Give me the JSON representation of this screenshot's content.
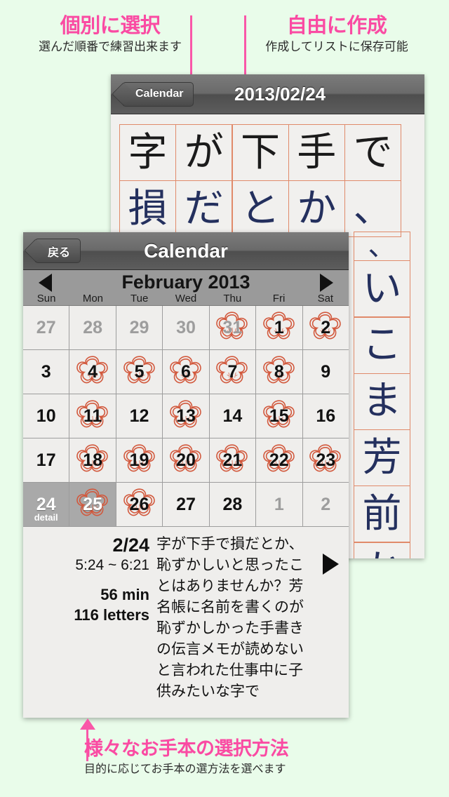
{
  "theme": {
    "page_background": "#e9fcea",
    "accent_pink": "#fa4ba3",
    "paper": "#efeeec",
    "stamp_red": "#d9583c",
    "selected_gray": "#a9a9a9"
  },
  "annotations": {
    "left": {
      "title": "個別に選択",
      "subtitle": "選んだ順番で練習出来ます"
    },
    "right": {
      "title": "自由に作成",
      "subtitle": "作成してリストに保存可能"
    },
    "bottom": {
      "title": "様々なお手本の選択方法",
      "subtitle": "目的に応じてお手本の選方法を選べます"
    }
  },
  "practice_app": {
    "navbar": {
      "back_label": "Calendar",
      "title": "2013/02/24"
    },
    "grid_rows": [
      [
        "字",
        "が",
        "下",
        "手",
        "で"
      ],
      [
        "損",
        "だ",
        "と",
        "か",
        "、"
      ]
    ],
    "right_column": [
      "、",
      "い",
      "こ",
      "ま",
      "芳",
      "前",
      "か"
    ]
  },
  "calendar": {
    "navbar": {
      "back_label": "戻る",
      "title": "Calendar"
    },
    "month_label": "February 2013",
    "prev_icon": "left-triangle-icon",
    "next_icon": "right-triangle-icon",
    "weekday_headers": [
      "Sun",
      "Mon",
      "Tue",
      "Wed",
      "Thu",
      "Fri",
      "Sat"
    ],
    "detail_label": "detail",
    "weeks": [
      [
        {
          "n": "27",
          "out": true,
          "stamp": false,
          "sel": false
        },
        {
          "n": "28",
          "out": true,
          "stamp": false,
          "sel": false
        },
        {
          "n": "29",
          "out": true,
          "stamp": false,
          "sel": false
        },
        {
          "n": "30",
          "out": true,
          "stamp": false,
          "sel": false
        },
        {
          "n": "31",
          "out": true,
          "stamp": true,
          "sel": false
        },
        {
          "n": "1",
          "out": false,
          "stamp": true,
          "sel": false
        },
        {
          "n": "2",
          "out": false,
          "stamp": true,
          "sel": false
        }
      ],
      [
        {
          "n": "3",
          "out": false,
          "stamp": false,
          "sel": false
        },
        {
          "n": "4",
          "out": false,
          "stamp": true,
          "sel": false
        },
        {
          "n": "5",
          "out": false,
          "stamp": true,
          "sel": false
        },
        {
          "n": "6",
          "out": false,
          "stamp": true,
          "sel": false
        },
        {
          "n": "7",
          "out": false,
          "stamp": true,
          "sel": false
        },
        {
          "n": "8",
          "out": false,
          "stamp": true,
          "sel": false
        },
        {
          "n": "9",
          "out": false,
          "stamp": false,
          "sel": false
        }
      ],
      [
        {
          "n": "10",
          "out": false,
          "stamp": false,
          "sel": false
        },
        {
          "n": "11",
          "out": false,
          "stamp": true,
          "sel": false
        },
        {
          "n": "12",
          "out": false,
          "stamp": false,
          "sel": false
        },
        {
          "n": "13",
          "out": false,
          "stamp": true,
          "sel": false
        },
        {
          "n": "14",
          "out": false,
          "stamp": false,
          "sel": false
        },
        {
          "n": "15",
          "out": false,
          "stamp": true,
          "sel": false
        },
        {
          "n": "16",
          "out": false,
          "stamp": false,
          "sel": false
        }
      ],
      [
        {
          "n": "17",
          "out": false,
          "stamp": false,
          "sel": false
        },
        {
          "n": "18",
          "out": false,
          "stamp": true,
          "sel": false
        },
        {
          "n": "19",
          "out": false,
          "stamp": true,
          "sel": false
        },
        {
          "n": "20",
          "out": false,
          "stamp": true,
          "sel": false
        },
        {
          "n": "21",
          "out": false,
          "stamp": true,
          "sel": false
        },
        {
          "n": "22",
          "out": false,
          "stamp": true,
          "sel": false
        },
        {
          "n": "23",
          "out": false,
          "stamp": true,
          "sel": false
        }
      ],
      [
        {
          "n": "24",
          "out": false,
          "stamp": false,
          "sel": true,
          "detail": true
        },
        {
          "n": "25",
          "out": false,
          "stamp": true,
          "sel": true
        },
        {
          "n": "26",
          "out": false,
          "stamp": true,
          "sel": false
        },
        {
          "n": "27",
          "out": false,
          "stamp": false,
          "sel": false
        },
        {
          "n": "28",
          "out": false,
          "stamp": false,
          "sel": false
        },
        {
          "n": "1",
          "out": true,
          "stamp": false,
          "sel": false
        },
        {
          "n": "2",
          "out": true,
          "stamp": false,
          "sel": false
        }
      ]
    ],
    "detail": {
      "date": "2/24",
      "time_range": "5:24 ~ 6:21",
      "duration": "56 min",
      "letters": "116 letters",
      "body": "字が下手で損だとか、恥ずかしいと思ったことはありませんか？芳名帳に名前を書くのが恥ずかしかった手書きの伝言メモが読めないと言われた仕事中に子供みたいな字で",
      "play_icon": "play-triangle-icon"
    }
  }
}
